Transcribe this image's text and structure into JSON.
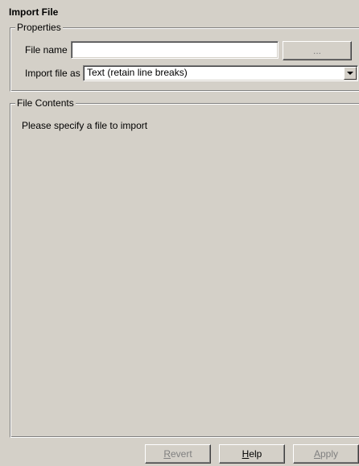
{
  "dialog": {
    "title": "Import File"
  },
  "properties": {
    "group_label": "Properties",
    "file_name_label": "File name",
    "file_name_value": "",
    "browse_label": "...",
    "import_as_label": "Import file as",
    "import_as_selected": "Text (retain line breaks)"
  },
  "contents": {
    "group_label": "File Contents",
    "message": "Please specify a file to import"
  },
  "footer": {
    "revert": {
      "accel": "R",
      "rest": "evert"
    },
    "help": {
      "accel": "H",
      "rest": "elp"
    },
    "apply": {
      "accel": "A",
      "rest": "pply"
    }
  }
}
